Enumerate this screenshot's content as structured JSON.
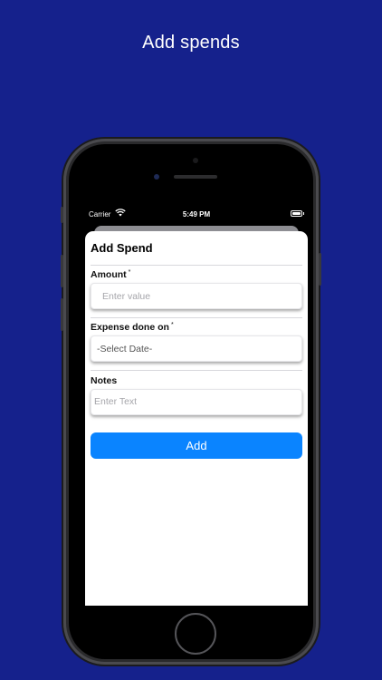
{
  "headline": "Add spends",
  "status_bar": {
    "carrier": "Carrier",
    "time": "5:49 PM"
  },
  "sheet": {
    "title": "Add Spend",
    "amount": {
      "label": "Amount",
      "required_mark": "*",
      "placeholder": "Enter value"
    },
    "expense_date": {
      "label": "Expense done on",
      "required_mark": "*",
      "value": "-Select Date-"
    },
    "notes": {
      "label": "Notes",
      "placeholder": "Enter Text"
    },
    "add_button": "Add"
  },
  "colors": {
    "background": "#15218c",
    "accent": "#0a84ff"
  }
}
